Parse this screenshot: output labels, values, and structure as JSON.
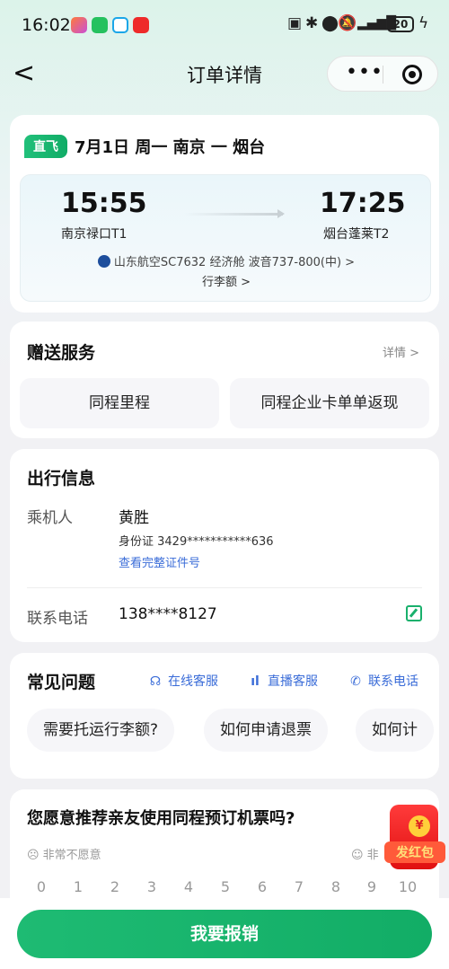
{
  "status_bar": {
    "time": "16:02",
    "battery": "20"
  },
  "nav": {
    "back": "<",
    "title": "订单详情",
    "more": "•••"
  },
  "flight": {
    "tag": "直飞",
    "header": "7月1日 周一 南京 一 烟台",
    "depart_time": "15:55",
    "depart_airport": "南京禄口T1",
    "arrive_time": "17:25",
    "arrive_airport": "烟台蓬莱T2",
    "airline_info": "山东航空SC7632 经济舱 波音737-800(中) >",
    "baggage": "行李额 >"
  },
  "services": {
    "title": "赠送服务",
    "more": "详情 >",
    "items": [
      "同程里程",
      "同程企业卡单单返现"
    ]
  },
  "travel": {
    "title": "出行信息",
    "passenger_label": "乘机人",
    "passenger_name": "黄胜",
    "id_text": "身份证  3429***********636",
    "view_id": "查看完整证件号",
    "phone_label": "联系电话",
    "phone": "138****8127"
  },
  "faq": {
    "title": "常见问题",
    "links": [
      "在线客服",
      "直播客服",
      "联系电话"
    ],
    "questions": [
      "需要托运行李额?",
      "如何申请退票",
      "如何计"
    ]
  },
  "survey": {
    "question": "您愿意推荐亲友使用同程预订机票吗?",
    "low_label": "☹ 非常不愿意",
    "high_label": "☺ 非",
    "scale": [
      "0",
      "1",
      "2",
      "3",
      "4",
      "5",
      "6",
      "7",
      "8",
      "9",
      "10"
    ]
  },
  "red_packet": {
    "label": "发红包",
    "coin": "¥"
  },
  "action": {
    "button": "我要报销"
  }
}
